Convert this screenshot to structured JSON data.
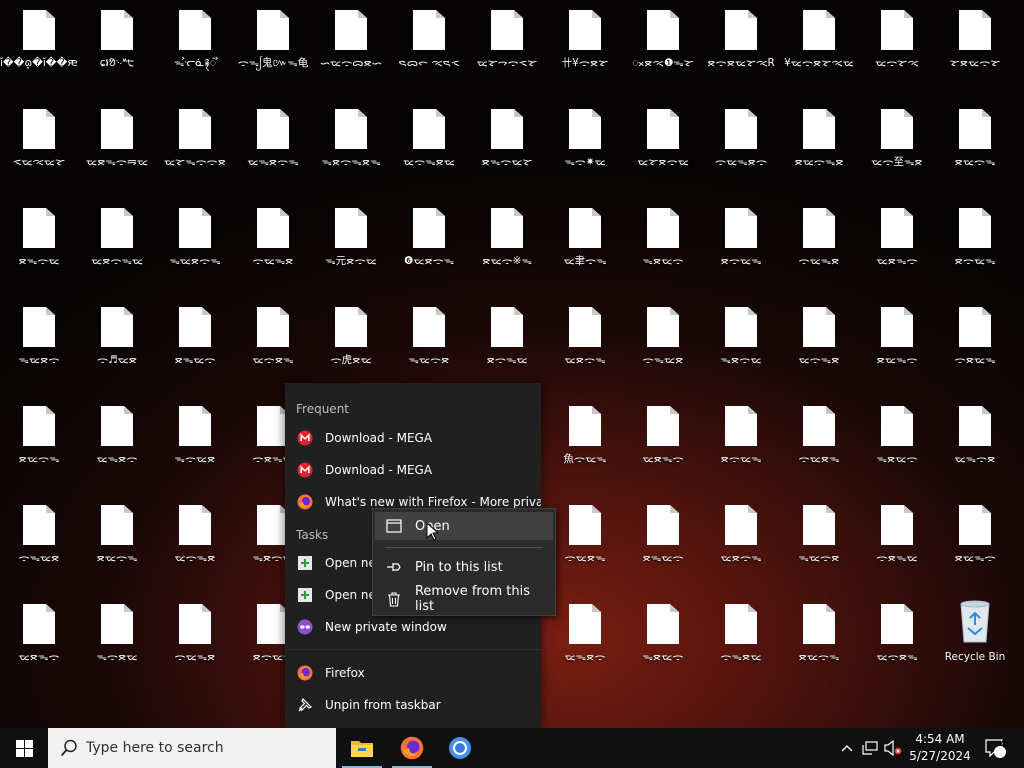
{
  "desktop": {
    "icons": [
      [
        "ĭ��ܷɷ�ĭ��ԙ��",
        "ɕ៛ᱚ࿙ᔿ੮",
        "ᯓᯨᓞᓈ࿑ᯭ",
        "ᯙᯓᩭ鬼៚ᯓ龟",
        "ᯈᯔᯙᯅᯖᯈ",
        "ᯍᯅᯞ ᯕᯍᯑ",
        "ᯔᯘᯎᯙᯑᯘ",
        "卄¥ᯙᯖᯘ",
        "ᯬᯖᯕ❶ᯓᯘ",
        "ᯖᯙᯖᯔᯘᯕR",
        "¥ᯔᯙᯖᯘᯕᯔ",
        "ᯔᯙᯘᯕ",
        "ᯘᯖᯔᯙᯘ"
      ],
      [
        "ᯑᯔᯕᯔᯘ",
        "ᯔᯖᯓᯙᯒᯔ",
        "ᯔᯘᯓᯙᯙᯖ",
        "ᯔᯓᯖᯙᯓ",
        "ᯓᯖᯙᯓᯖᯓ",
        "ᯔᯙᯓᯖᯔ",
        "ᯖᯓᯙᯔᯘ",
        "ᯓᯙ✷ᯔ",
        "ᯔᯘᯖᯙᯔ",
        "ᯙᯔᯓᯖᯙ",
        "ᯖᯔᯙᯓᯖ",
        "ᯔᯙ至ᯓᯖ",
        "ᯖᯔᯙᯓ"
      ],
      [
        "ᯖᯓᯙᯔ",
        "ᯔᯖᯙᯓᯔ",
        "ᯓᯔᯖᯙᯓ",
        "ᯙᯔᯓᯖ",
        "ᯓ元ᯖᯙᯔ",
        "❻ᯔᯖᯙᯓ",
        "ᯖᯔᯙ※ᯓ",
        "ᯔ聿ᯙᯓ",
        "ᯓᯖᯔᯙ",
        "ᯖᯙᯔᯓ",
        "ᯙᯔᯓᯖ",
        "ᯔᯖᯓᯙ",
        "ᯖᯙᯔᯓ"
      ],
      [
        "ᯓᯔᯖᯙ",
        "ᯙ♬ᯔᯖ",
        "ᯖᯓᯔᯙ",
        "ᯔᯙᯖᯓ",
        "ᯙ虎ᯖᯔ",
        "ᯓᯔᯙᯖ",
        "ᯖᯙᯓᯔ",
        "ᯔᯖᯙᯓ",
        "ᯙᯓᯔᯖ",
        "ᯓᯖᯙᯔ",
        "ᯔᯙᯓᯖ",
        "ᯖᯔᯓᯙ",
        "ᯙᯖᯔᯓ"
      ],
      [
        "ᯖᯔᯙᯓ",
        "ᯔᯓᯖᯙ",
        "ᯓᯙᯔᯖ",
        "ᯙᯖᯓᯔ",
        "",
        "",
        "",
        "魚ᯙᯔᯓ",
        "ᯔᯖᯓᯙ",
        "ᯖᯙᯔᯓ",
        "ᯙᯔᯖᯓ",
        "ᯓᯖᯔᯙ",
        "ᯔᯓᯙᯖ"
      ],
      [
        "ᯙᯓᯔᯖ",
        "ᯖᯔᯙᯓ",
        "ᯔᯙᯓᯖ",
        "ᯓᯖᯙᯔ",
        "",
        "",
        "",
        "ᯙᯔᯖᯓ",
        "ᯖᯓᯔᯙ",
        "ᯔᯖᯙᯓ",
        "ᯓᯔᯙᯖ",
        "ᯙᯖᯓᯔ",
        "ᯖᯔᯓᯙ"
      ],
      [
        "ᯔᯖᯓᯙ",
        "ᯓᯙᯖᯔ",
        "ᯙᯔᯓᯖ",
        "ᯖᯙᯔᯓ",
        "",
        "",
        "",
        "ᯔᯓᯖᯙ",
        "ᯓᯖᯔᯙ",
        "ᯙᯓᯖᯔ",
        "ᯖᯔᯙᯓ",
        "ᯔᯙᯖᯓ",
        "Recycle Bin"
      ]
    ]
  },
  "jumplist": {
    "frequent_header": "Frequent",
    "frequent": [
      {
        "label": "Download - MEGA",
        "icon": "mega-icon"
      },
      {
        "label": "Download - MEGA",
        "icon": "mega-icon"
      },
      {
        "label": "What's new with Firefox - More privac...",
        "icon": "firefox-icon"
      }
    ],
    "tasks_header": "Tasks",
    "tasks": [
      {
        "label": "Open ne",
        "icon": "new-tab-icon"
      },
      {
        "label": "Open ne",
        "icon": "new-window-icon"
      },
      {
        "label": "New private window",
        "icon": "private-window-icon"
      }
    ],
    "app": {
      "label": "Firefox",
      "icon": "firefox-icon"
    },
    "unpin": {
      "label": "Unpin from taskbar",
      "icon": "unpin-icon"
    }
  },
  "context_menu": {
    "open": "Open",
    "pin": "Pin to this list",
    "remove": "Remove from this list"
  },
  "taskbar": {
    "search_placeholder": "Type here to search",
    "apps": [
      "file-explorer-icon",
      "firefox-icon",
      "chromium-icon"
    ],
    "clock_time": "4:54 AM",
    "clock_date": "5/27/2024",
    "notification_count": "4"
  },
  "colors": {
    "accent": "#86b7e3",
    "mega_red": "#d9272e",
    "firefox_orange": "#ff7139",
    "private_purple": "#8f4fd1",
    "taskbar_bg": "#101010"
  }
}
